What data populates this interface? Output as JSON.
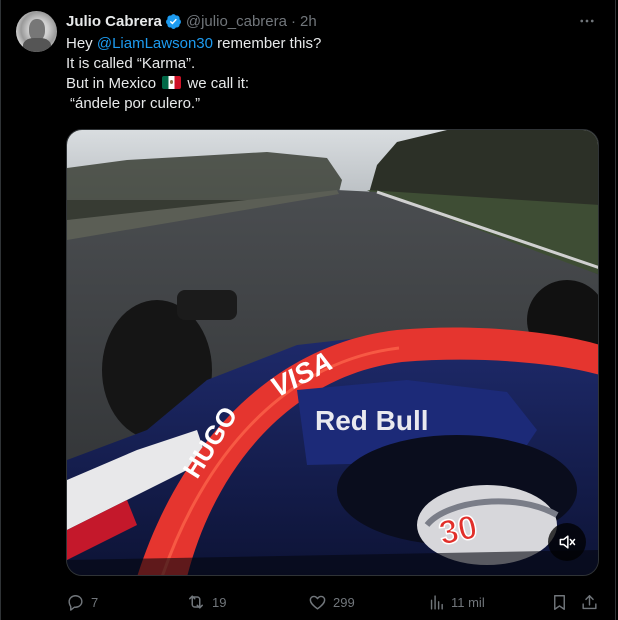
{
  "tweet": {
    "author_name": "Julio Cabrera",
    "handle": "@julio_cabrera",
    "separator": "·",
    "time": "2h",
    "text": {
      "line1_prefix": "Hey ",
      "mention": "@LiamLawson30",
      "line1_suffix": " remember this?",
      "line2": "It is called “Karma”.",
      "line3_prefix": "But in Mexico ",
      "line3_suffix": " we call it:",
      "line4": "“ándele por culero.”"
    },
    "video_overlay_text": {
      "halo_sponsor_1": "HUGO",
      "halo_sponsor_2": "VISA",
      "engine_cover": "Red Bull",
      "car_number": "30"
    },
    "actions": {
      "replies": "7",
      "retweets": "19",
      "likes": "299",
      "views": "11 mil"
    }
  },
  "colors": {
    "background": "#000000",
    "text": "#e7e9ea",
    "secondary": "#71767b",
    "accent": "#1d9bf0",
    "verified": "#1d9bf0"
  },
  "icons": {
    "verified": "verified-badge-icon",
    "more": "more-dots-icon",
    "mute": "muted-speaker-icon",
    "reply": "reply-bubble-icon",
    "retweet": "retweet-icon",
    "like": "heart-icon",
    "views": "views-bars-icon",
    "bookmark": "bookmark-icon",
    "share": "share-icon"
  }
}
